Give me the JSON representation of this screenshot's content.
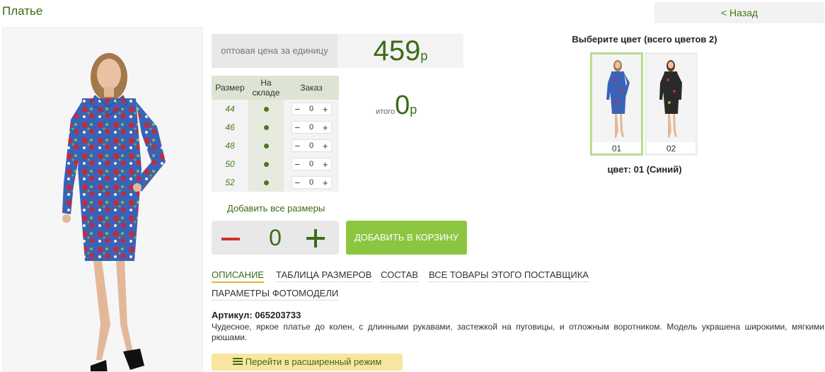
{
  "page": {
    "title": "Платье",
    "back_label": "< Назад"
  },
  "price": {
    "label": "оптовая цена за единицу",
    "value": "459",
    "currency": "р"
  },
  "sizes_table": {
    "headers": [
      "Размер",
      "На складе",
      "Заказ"
    ],
    "rows": [
      {
        "size": "44",
        "qty": "0"
      },
      {
        "size": "46",
        "qty": "0"
      },
      {
        "size": "48",
        "qty": "0"
      },
      {
        "size": "50",
        "qty": "0"
      },
      {
        "size": "52",
        "qty": "0"
      }
    ],
    "minus": "−",
    "plus": "+"
  },
  "total": {
    "label": "итого",
    "value": "0",
    "currency": "р"
  },
  "add_all_label": "Добавить все размеры",
  "big_stepper": {
    "value": "0"
  },
  "add_to_cart_label": "ДОБАВИТЬ В КОРЗИНУ",
  "tabs": [
    {
      "label": "ОПИСАНИЕ",
      "active": true
    },
    {
      "label": "ТАБЛИЦА РАЗМЕРОВ",
      "active": false
    },
    {
      "label": "СОСТАВ",
      "active": false
    },
    {
      "label": "ВСЕ ТОВАРЫ ЭТОГО ПОСТАВЩИКА",
      "active": false
    },
    {
      "label": "ПАРАМЕТРЫ ФОТОМОДЕЛИ",
      "active": false
    }
  ],
  "article": "Артикул: 065203733",
  "description": "Чудесное, яркое платье до колен, с длинными рукавами, застежкой на пуговицы, и отложным воротником. Модель украшена широкими, мягкими рюшами.",
  "expand_label": "Перейти в расширенный режим",
  "colors": {
    "title": "Выберите цвет (всего цветов 2)",
    "swatches": [
      {
        "label": "01",
        "selected": true,
        "dress_color": "#3a63b8"
      },
      {
        "label": "02",
        "selected": false,
        "dress_color": "#2a2a2a"
      }
    ],
    "selected_label": "цвет: 01 (Синий)"
  },
  "colors_accent": {
    "green": "#3d6b17",
    "button": "#8cc640",
    "tab_underline": "#e3b72a"
  }
}
